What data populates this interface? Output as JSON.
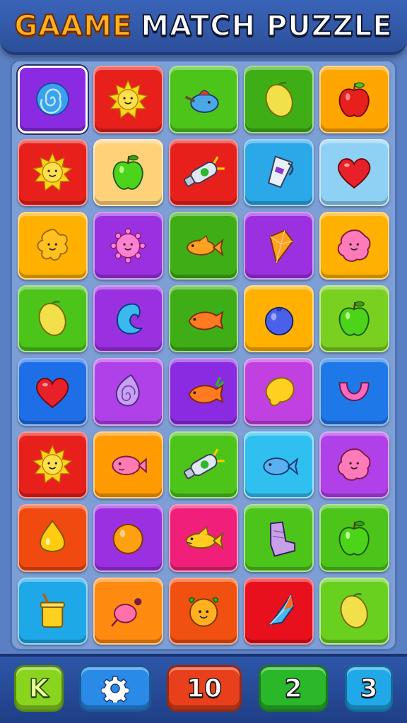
{
  "header": {
    "title_part1": "GAAME",
    "title_part2": "MATCH PUZZLE"
  },
  "colors": {
    "header_bg": "#2c4f9a",
    "board_bg": "#7d9fd6",
    "title_orange": "#ffb020",
    "bottom_bar": "#1f3f86"
  },
  "board": {
    "rows": 8,
    "cols": 5,
    "tiles": [
      [
        {
          "bg": "#8a2be2",
          "icon": "swirl-candy"
        },
        {
          "bg": "#e8201c",
          "icon": "sun"
        },
        {
          "bg": "#4cc41a",
          "icon": "teapot-bird"
        },
        {
          "bg": "#3fae16",
          "icon": "lemon"
        },
        {
          "bg": "#ffa500",
          "icon": "red-apple"
        }
      ],
      [
        {
          "bg": "#e8201c",
          "icon": "sun"
        },
        {
          "bg": "#ffd27a",
          "icon": "green-apple"
        },
        {
          "bg": "#e8201c",
          "icon": "bottle"
        },
        {
          "bg": "#2aa8e8",
          "icon": "pitcher"
        },
        {
          "bg": "#8fd0f5",
          "icon": "heart"
        }
      ],
      [
        {
          "bg": "#ffb000",
          "icon": "star-flower"
        },
        {
          "bg": "#9b30e0",
          "icon": "pink-gear"
        },
        {
          "bg": "#3fae16",
          "icon": "orange-fish"
        },
        {
          "bg": "#9b30e0",
          "icon": "gem"
        },
        {
          "bg": "#ffb000",
          "icon": "pink-blob"
        }
      ],
      [
        {
          "bg": "#4cc41a",
          "icon": "lemon"
        },
        {
          "bg": "#9b30e0",
          "icon": "blue-moon"
        },
        {
          "bg": "#3fae16",
          "icon": "carrot-fish"
        },
        {
          "bg": "#ffb000",
          "icon": "blueberry"
        },
        {
          "bg": "#7ad020",
          "icon": "green-apple"
        }
      ],
      [
        {
          "bg": "#1e6ee8",
          "icon": "heart"
        },
        {
          "bg": "#b040e8",
          "icon": "swirl-drop"
        },
        {
          "bg": "#8a2be2",
          "icon": "carrot-fish"
        },
        {
          "bg": "#c040e0",
          "icon": "yellow-blob"
        },
        {
          "bg": "#1e78e8",
          "icon": "magnet"
        }
      ],
      [
        {
          "bg": "#e8201c",
          "icon": "sun"
        },
        {
          "bg": "#ff9a00",
          "icon": "pink-fish"
        },
        {
          "bg": "#4cc41a",
          "icon": "bottle"
        },
        {
          "bg": "#30c0f0",
          "icon": "blue-fish"
        },
        {
          "bg": "#b040e8",
          "icon": "pink-blob"
        }
      ],
      [
        {
          "bg": "#f04a10",
          "icon": "yellow-drop"
        },
        {
          "bg": "#9b30e0",
          "icon": "orange"
        },
        {
          "bg": "#f0207a",
          "icon": "yellow-fish"
        },
        {
          "bg": "#4cc41a",
          "icon": "boot"
        },
        {
          "bg": "#4cc41a",
          "icon": "green-apple"
        }
      ],
      [
        {
          "bg": "#1ea8e8",
          "icon": "juice-cup"
        },
        {
          "bg": "#ff8a10",
          "icon": "radish"
        },
        {
          "bg": "#f05010",
          "icon": "orange-face"
        },
        {
          "bg": "#e8101c",
          "icon": "kite"
        },
        {
          "bg": "#6ad020",
          "icon": "lemon"
        }
      ]
    ]
  },
  "bottom_bar": {
    "k_label": "K",
    "settings_icon": "gear-icon",
    "score_label": "10",
    "moves_label": "2",
    "level_label": "3",
    "k_color": "#8ad420",
    "settings_color": "#2a8ae8",
    "score_color": "#e8401c",
    "moves_color": "#2ab82a",
    "level_color": "#20a8e8"
  }
}
